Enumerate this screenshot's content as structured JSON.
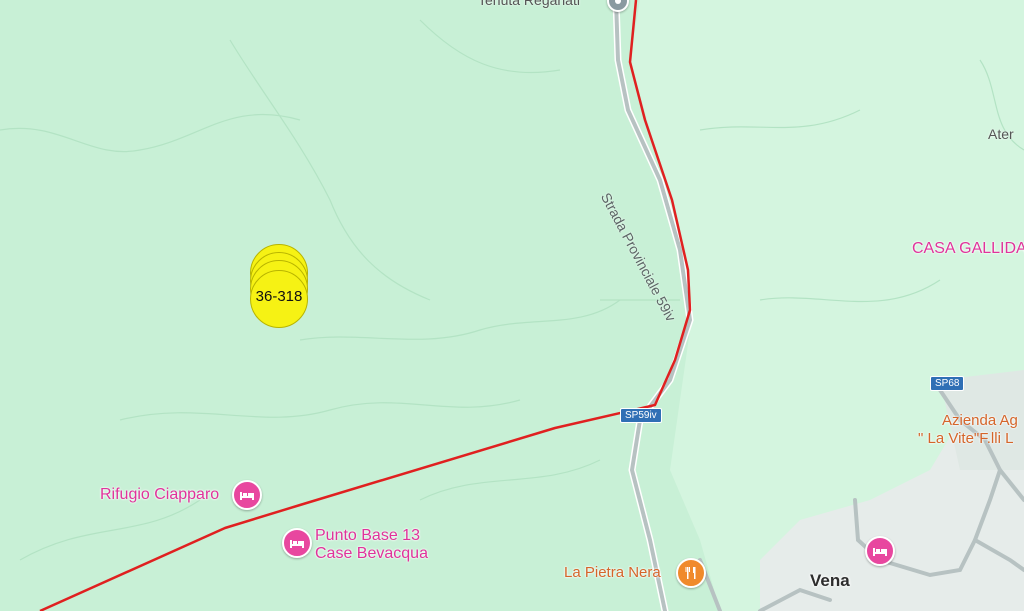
{
  "map": {
    "colors": {
      "forest": "#c8f0d6",
      "lighter_area": "#d8f6e2",
      "town_area": "#e8eeec",
      "road": "#b9c4c4",
      "route": "#e02020",
      "cluster": "#f6f214"
    },
    "cluster_label": "36-318",
    "road_label": "Strada Provinciale 59iv",
    "shields": {
      "sp59": "SP59iv",
      "sp68": "SP68"
    },
    "pois": {
      "tenuta": "Tenuta Reganati",
      "rifugio": "Rifugio Ciapparo",
      "punto_base_line1": "Punto Base 13",
      "punto_base_line2": "Case Bevacqua",
      "pietra_nera": "La Pietra Nera",
      "azienda_line1": "Azienda Ag",
      "azienda_line2": "\" La Vite\"F.lli L",
      "casa_gallida": "CASA GALLIDA",
      "ater": "Ater",
      "vena": "Vena"
    },
    "icons": {
      "lodging": "bed-icon",
      "restaurant": "fork-knife-icon",
      "place": "place-pin-icon"
    }
  }
}
